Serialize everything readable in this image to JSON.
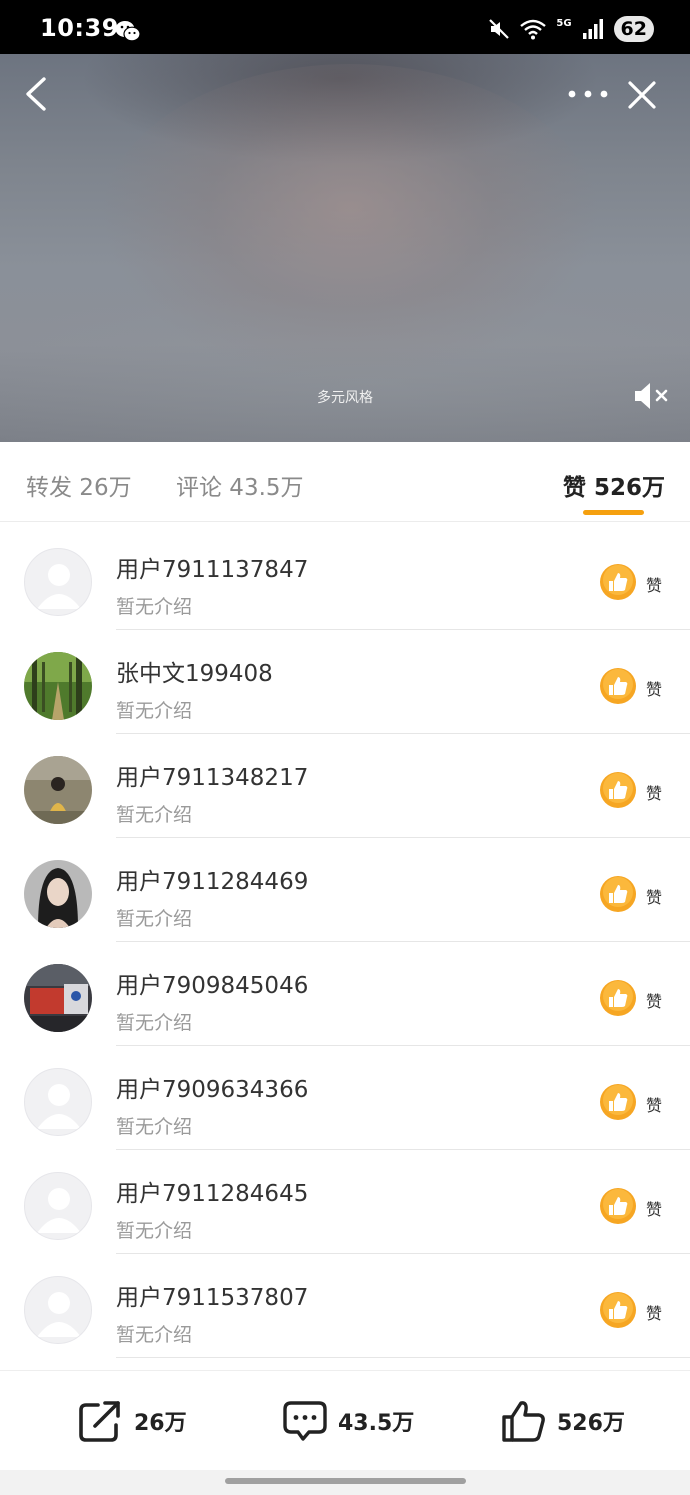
{
  "status_bar": {
    "time": "10:39",
    "battery": "62",
    "network": "5G",
    "icons": [
      "wechat-icon",
      "mute-icon",
      "wifi-icon",
      "signal-icon"
    ]
  },
  "video": {
    "caption": "多元风格",
    "icons": [
      "back-icon",
      "more-icon",
      "close-icon",
      "volume-mute-icon"
    ]
  },
  "tabs": [
    {
      "label": "转发 26万"
    },
    {
      "label": "评论 43.5万"
    },
    {
      "label": "赞 526万",
      "active": true
    }
  ],
  "like_button_label": "赞",
  "users": [
    {
      "name": "用户7911137847",
      "intro": "暂无介绍",
      "avatar": "default"
    },
    {
      "name": "张中文199408",
      "intro": "暂无介绍",
      "avatar": "forest"
    },
    {
      "name": "用户7911348217",
      "intro": "暂无介绍",
      "avatar": "person-outdoor"
    },
    {
      "name": "用户7911284469",
      "intro": "暂无介绍",
      "avatar": "woman-portrait"
    },
    {
      "name": "用户7909845046",
      "intro": "暂无介绍",
      "avatar": "street-scene"
    },
    {
      "name": "用户7909634366",
      "intro": "暂无介绍",
      "avatar": "default"
    },
    {
      "name": "用户7911284645",
      "intro": "暂无介绍",
      "avatar": "default"
    },
    {
      "name": "用户7911537807",
      "intro": "暂无介绍",
      "avatar": "default"
    }
  ],
  "bottom_bar": {
    "repost_count": "26万",
    "comment_count": "43.5万",
    "like_count": "526万"
  },
  "colors": {
    "accent": "#f5a00f",
    "like_icon": "#f6a623",
    "text_primary": "#333333",
    "text_secondary": "#9a9a9a"
  }
}
